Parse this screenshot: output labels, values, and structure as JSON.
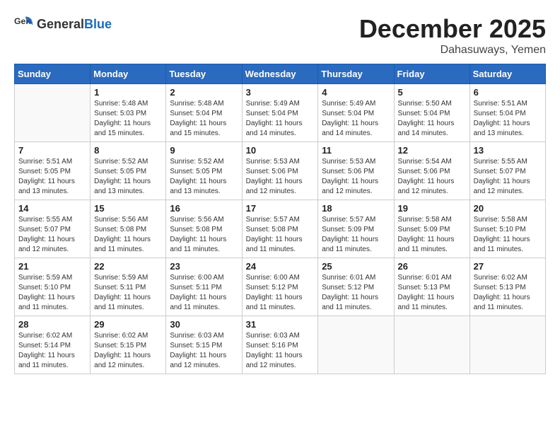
{
  "logo": {
    "general": "General",
    "blue": "Blue"
  },
  "header": {
    "month": "December 2025",
    "location": "Dahasuways, Yemen"
  },
  "weekdays": [
    "Sunday",
    "Monday",
    "Tuesday",
    "Wednesday",
    "Thursday",
    "Friday",
    "Saturday"
  ],
  "weeks": [
    [
      {
        "day": "",
        "sunrise": "",
        "sunset": "",
        "daylight": ""
      },
      {
        "day": "1",
        "sunrise": "Sunrise: 5:48 AM",
        "sunset": "Sunset: 5:03 PM",
        "daylight": "Daylight: 11 hours and 15 minutes."
      },
      {
        "day": "2",
        "sunrise": "Sunrise: 5:48 AM",
        "sunset": "Sunset: 5:04 PM",
        "daylight": "Daylight: 11 hours and 15 minutes."
      },
      {
        "day": "3",
        "sunrise": "Sunrise: 5:49 AM",
        "sunset": "Sunset: 5:04 PM",
        "daylight": "Daylight: 11 hours and 14 minutes."
      },
      {
        "day": "4",
        "sunrise": "Sunrise: 5:49 AM",
        "sunset": "Sunset: 5:04 PM",
        "daylight": "Daylight: 11 hours and 14 minutes."
      },
      {
        "day": "5",
        "sunrise": "Sunrise: 5:50 AM",
        "sunset": "Sunset: 5:04 PM",
        "daylight": "Daylight: 11 hours and 14 minutes."
      },
      {
        "day": "6",
        "sunrise": "Sunrise: 5:51 AM",
        "sunset": "Sunset: 5:04 PM",
        "daylight": "Daylight: 11 hours and 13 minutes."
      }
    ],
    [
      {
        "day": "7",
        "sunrise": "Sunrise: 5:51 AM",
        "sunset": "Sunset: 5:05 PM",
        "daylight": "Daylight: 11 hours and 13 minutes."
      },
      {
        "day": "8",
        "sunrise": "Sunrise: 5:52 AM",
        "sunset": "Sunset: 5:05 PM",
        "daylight": "Daylight: 11 hours and 13 minutes."
      },
      {
        "day": "9",
        "sunrise": "Sunrise: 5:52 AM",
        "sunset": "Sunset: 5:05 PM",
        "daylight": "Daylight: 11 hours and 13 minutes."
      },
      {
        "day": "10",
        "sunrise": "Sunrise: 5:53 AM",
        "sunset": "Sunset: 5:06 PM",
        "daylight": "Daylight: 11 hours and 12 minutes."
      },
      {
        "day": "11",
        "sunrise": "Sunrise: 5:53 AM",
        "sunset": "Sunset: 5:06 PM",
        "daylight": "Daylight: 11 hours and 12 minutes."
      },
      {
        "day": "12",
        "sunrise": "Sunrise: 5:54 AM",
        "sunset": "Sunset: 5:06 PM",
        "daylight": "Daylight: 11 hours and 12 minutes."
      },
      {
        "day": "13",
        "sunrise": "Sunrise: 5:55 AM",
        "sunset": "Sunset: 5:07 PM",
        "daylight": "Daylight: 11 hours and 12 minutes."
      }
    ],
    [
      {
        "day": "14",
        "sunrise": "Sunrise: 5:55 AM",
        "sunset": "Sunset: 5:07 PM",
        "daylight": "Daylight: 11 hours and 12 minutes."
      },
      {
        "day": "15",
        "sunrise": "Sunrise: 5:56 AM",
        "sunset": "Sunset: 5:08 PM",
        "daylight": "Daylight: 11 hours and 11 minutes."
      },
      {
        "day": "16",
        "sunrise": "Sunrise: 5:56 AM",
        "sunset": "Sunset: 5:08 PM",
        "daylight": "Daylight: 11 hours and 11 minutes."
      },
      {
        "day": "17",
        "sunrise": "Sunrise: 5:57 AM",
        "sunset": "Sunset: 5:08 PM",
        "daylight": "Daylight: 11 hours and 11 minutes."
      },
      {
        "day": "18",
        "sunrise": "Sunrise: 5:57 AM",
        "sunset": "Sunset: 5:09 PM",
        "daylight": "Daylight: 11 hours and 11 minutes."
      },
      {
        "day": "19",
        "sunrise": "Sunrise: 5:58 AM",
        "sunset": "Sunset: 5:09 PM",
        "daylight": "Daylight: 11 hours and 11 minutes."
      },
      {
        "day": "20",
        "sunrise": "Sunrise: 5:58 AM",
        "sunset": "Sunset: 5:10 PM",
        "daylight": "Daylight: 11 hours and 11 minutes."
      }
    ],
    [
      {
        "day": "21",
        "sunrise": "Sunrise: 5:59 AM",
        "sunset": "Sunset: 5:10 PM",
        "daylight": "Daylight: 11 hours and 11 minutes."
      },
      {
        "day": "22",
        "sunrise": "Sunrise: 5:59 AM",
        "sunset": "Sunset: 5:11 PM",
        "daylight": "Daylight: 11 hours and 11 minutes."
      },
      {
        "day": "23",
        "sunrise": "Sunrise: 6:00 AM",
        "sunset": "Sunset: 5:11 PM",
        "daylight": "Daylight: 11 hours and 11 minutes."
      },
      {
        "day": "24",
        "sunrise": "Sunrise: 6:00 AM",
        "sunset": "Sunset: 5:12 PM",
        "daylight": "Daylight: 11 hours and 11 minutes."
      },
      {
        "day": "25",
        "sunrise": "Sunrise: 6:01 AM",
        "sunset": "Sunset: 5:12 PM",
        "daylight": "Daylight: 11 hours and 11 minutes."
      },
      {
        "day": "26",
        "sunrise": "Sunrise: 6:01 AM",
        "sunset": "Sunset: 5:13 PM",
        "daylight": "Daylight: 11 hours and 11 minutes."
      },
      {
        "day": "27",
        "sunrise": "Sunrise: 6:02 AM",
        "sunset": "Sunset: 5:13 PM",
        "daylight": "Daylight: 11 hours and 11 minutes."
      }
    ],
    [
      {
        "day": "28",
        "sunrise": "Sunrise: 6:02 AM",
        "sunset": "Sunset: 5:14 PM",
        "daylight": "Daylight: 11 hours and 11 minutes."
      },
      {
        "day": "29",
        "sunrise": "Sunrise: 6:02 AM",
        "sunset": "Sunset: 5:15 PM",
        "daylight": "Daylight: 11 hours and 12 minutes."
      },
      {
        "day": "30",
        "sunrise": "Sunrise: 6:03 AM",
        "sunset": "Sunset: 5:15 PM",
        "daylight": "Daylight: 11 hours and 12 minutes."
      },
      {
        "day": "31",
        "sunrise": "Sunrise: 6:03 AM",
        "sunset": "Sunset: 5:16 PM",
        "daylight": "Daylight: 11 hours and 12 minutes."
      },
      {
        "day": "",
        "sunrise": "",
        "sunset": "",
        "daylight": ""
      },
      {
        "day": "",
        "sunrise": "",
        "sunset": "",
        "daylight": ""
      },
      {
        "day": "",
        "sunrise": "",
        "sunset": "",
        "daylight": ""
      }
    ]
  ]
}
